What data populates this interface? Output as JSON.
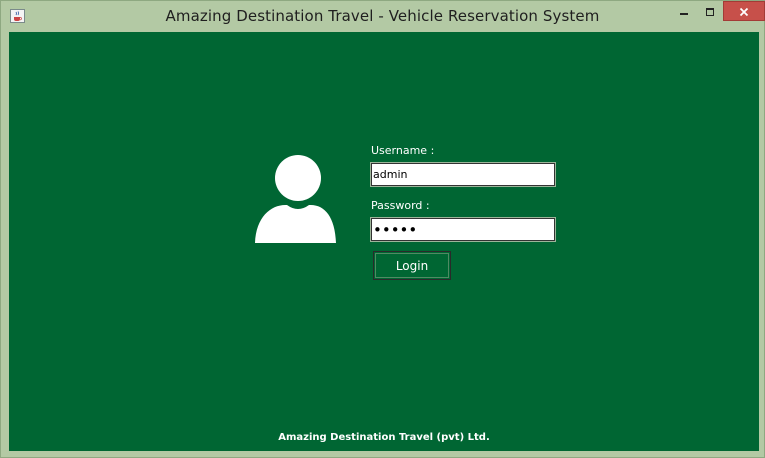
{
  "window": {
    "title": "Amazing Destination Travel - Vehicle Reservation System",
    "minimize_icon": "minimize-icon",
    "maximize_icon": "maximize-icon",
    "close_icon": "close-icon",
    "app_icon": "java-cup-icon"
  },
  "login": {
    "avatar_icon": "user-icon",
    "username_label": "Username :",
    "username_value": "admin",
    "password_label": "Password :",
    "password_value": "•••••",
    "login_button": "Login"
  },
  "footer": {
    "text": "Amazing Destination Travel (pvt) Ltd."
  },
  "colors": {
    "background": "#006633",
    "text": "#ffffff",
    "frame": "#b3c9a4",
    "close_button": "#c7504a"
  }
}
